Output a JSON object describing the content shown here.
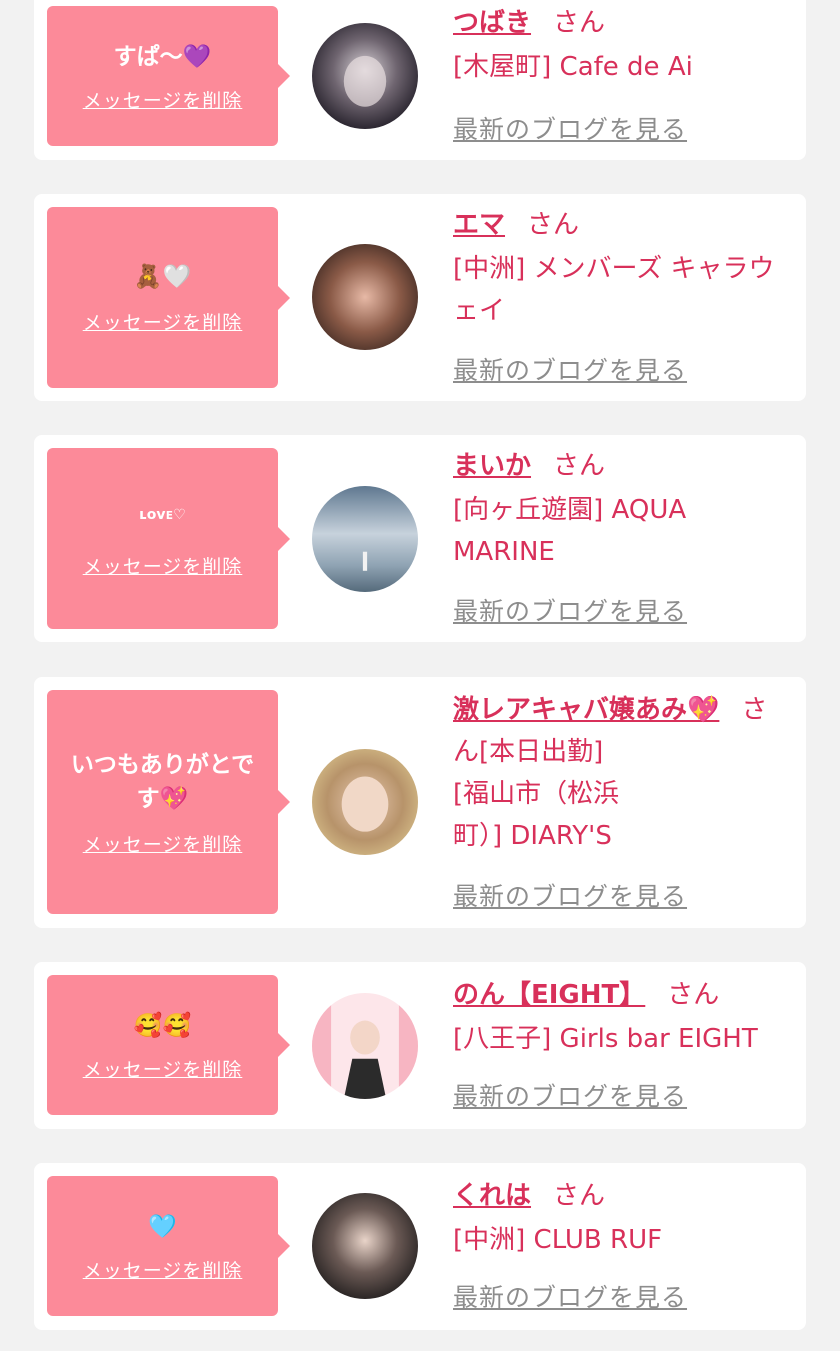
{
  "messages": [
    {
      "name": "つばき",
      "san": "さん",
      "shop": "[木屋町] Cafe de Ai",
      "message": "すぱ〜💜",
      "delete": "メッセージを削除",
      "blog": "最新のブログを見る"
    },
    {
      "name": "エマ",
      "san": "さん",
      "shop": "[中洲] メンバーズ キャラウェイ",
      "message": "🧸🤍",
      "delete": "メッセージを削除",
      "blog": "最新のブログを見る"
    },
    {
      "name": "まいか",
      "san": "さん",
      "shop": "[向ヶ丘遊園] AQUA MARINE",
      "message": "ʟᴏᴠᴇ♡",
      "delete": "メッセージを削除",
      "blog": "最新のブログを見る"
    },
    {
      "name": "激レアキャバ嬢あみ💖",
      "san": "さ",
      "shop_line1": "ん[本日出勤]",
      "shop_line2": "[福山市（松浜",
      "shop_line3": "町）] DIARY'S",
      "message": "いつもありがとです💖",
      "delete": "メッセージを削除",
      "blog": "最新のブログを見る"
    },
    {
      "name": "のん【EIGHT】",
      "san": "さん",
      "shop": "[八王子] Girls bar EIGHT",
      "message": "🥰🥰",
      "delete": "メッセージを削除",
      "blog": "最新のブログを見る"
    },
    {
      "name": "くれは",
      "san": "さん",
      "shop": "[中洲] CLUB RUF",
      "message": "🩵",
      "delete": "メッセージを削除",
      "blog": "最新のブログを見る"
    }
  ],
  "colors": {
    "bubble": "#fc8a99",
    "accent": "#d8305a",
    "link_gray": "#8d8d8d",
    "background": "#f2f2f2"
  }
}
